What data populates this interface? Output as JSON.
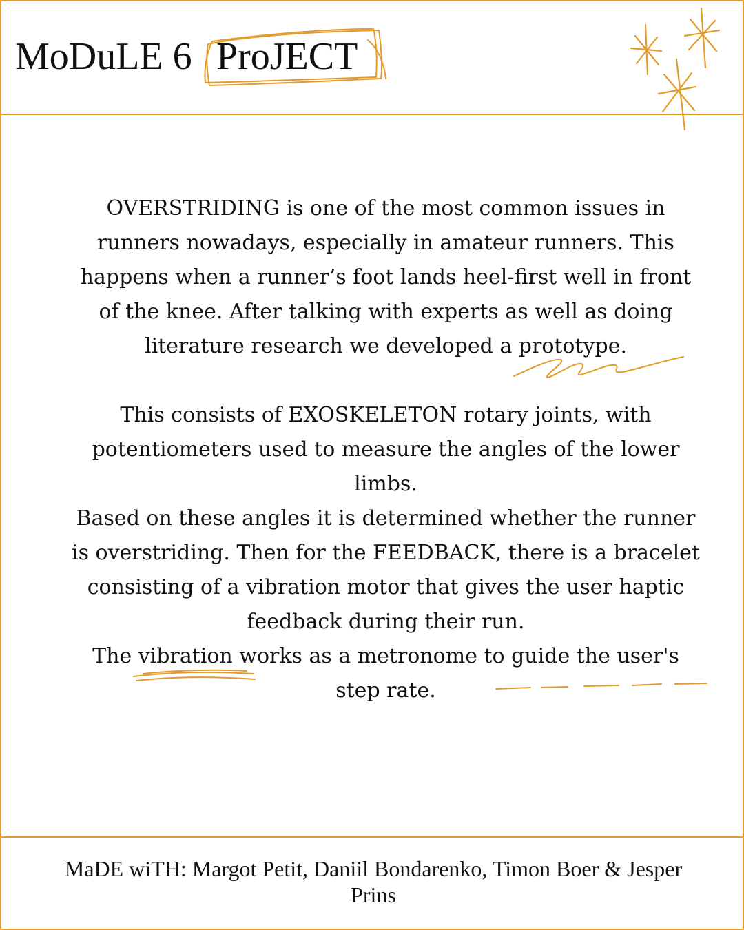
{
  "header": {
    "title_module": "MoDuLE 6",
    "title_project": "ProJECT"
  },
  "main": {
    "paragraph_1": "OVERSTRIDING  is one of the most common issues in runners nowadays, especially in amateur runners. This happens when a runner’s foot lands heel-first well in front of the knee. After talking with experts as well as doing literature research we developed a prototype.",
    "paragraph_2": "This consists of  EXOSKELETON rotary joints, with potentiometers used to measure the angles of the lower limbs.",
    "paragraph_3": "Based on these angles it is determined whether the runner is overstriding. Then for the FEEDBACK, there is a bracelet consisting of a vibration motor that gives the user haptic feedback during their run.",
    "paragraph_4": " The vibration works as a metronome to guide the user's step rate."
  },
  "footer": {
    "credits": "MaDE wiTH: Margot Petit, Daniil Bondarenko, Timon Boer & Jesper Prins"
  },
  "colors": {
    "accent": "#E39B2C",
    "text": "#111111",
    "background": "#FFFFFF"
  },
  "icons": [
    "sparkle-icon",
    "squiggle-decoration",
    "underline-decoration",
    "dashed-line-decoration",
    "box-scribble-decoration"
  ]
}
